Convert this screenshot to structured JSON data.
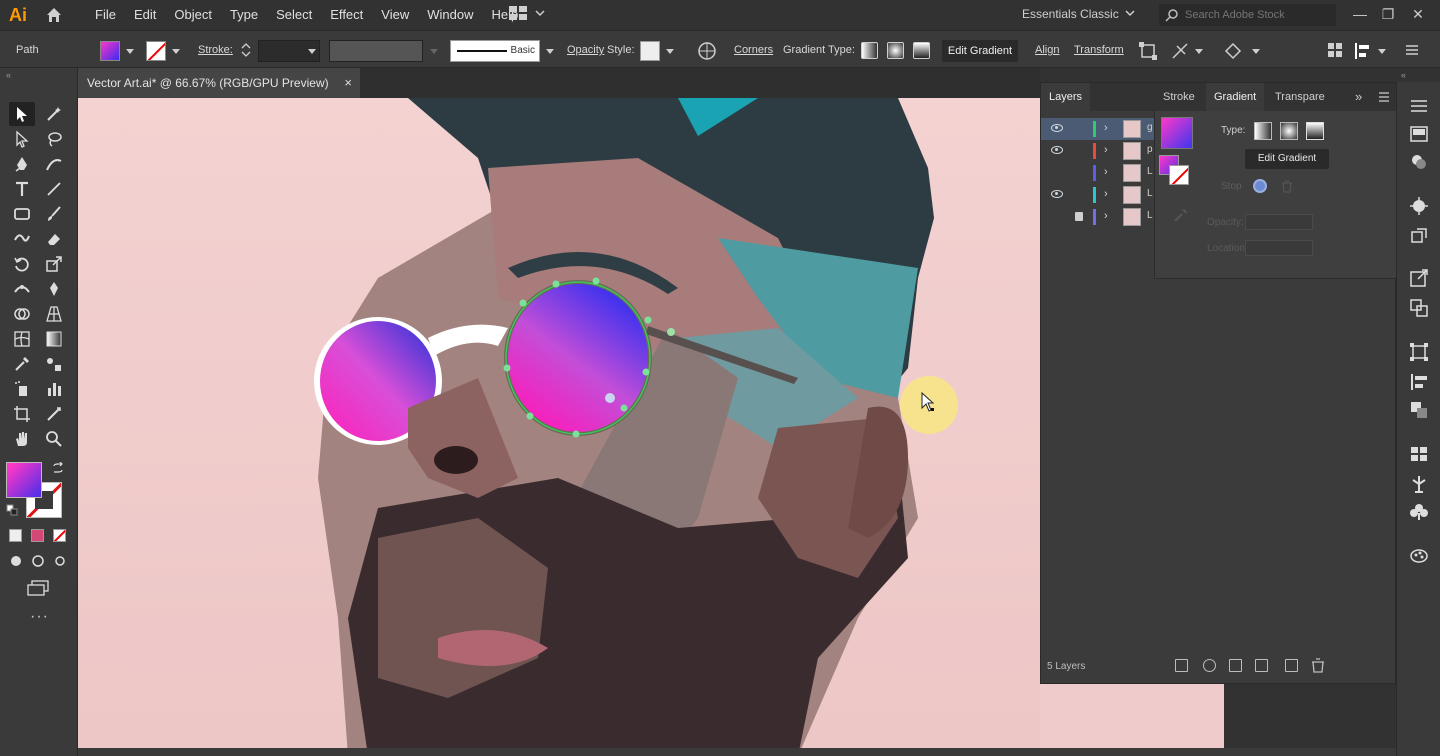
{
  "app": {
    "logo": "Ai",
    "workspace": "Essentials Classic",
    "stock_search_placeholder": "Search Adobe Stock"
  },
  "menu": [
    "File",
    "Edit",
    "Object",
    "Type",
    "Select",
    "Effect",
    "View",
    "Window",
    "Help"
  ],
  "control_bar": {
    "selection_type": "Path",
    "stroke_label": "Stroke:",
    "brush_label": "Basic",
    "opacity_label": "Opacity",
    "style_label": "Style:",
    "corners_label": "Corners",
    "gradient_type_label": "Gradient Type:",
    "edit_gradient_label": "Edit Gradient",
    "align_label": "Align",
    "transform_label": "Transform"
  },
  "document_tab": {
    "title": "Vector Art.ai* @ 66.67% (RGB/GPU Preview)",
    "close": "×"
  },
  "layers_panel": {
    "tabs": {
      "layers": "Layers",
      "stroke": "Stroke",
      "gradient": "Gradient",
      "transparency": "Transpare"
    },
    "expand": "»",
    "layers": [
      {
        "letter": "g",
        "color": "#2ecc71",
        "visible": true,
        "locked": false,
        "selected": true
      },
      {
        "letter": "p",
        "color": "#e74c3c",
        "visible": true,
        "locked": false,
        "selected": false
      },
      {
        "letter": "L",
        "color": "#5b5fe6",
        "visible": false,
        "locked": false,
        "selected": false
      },
      {
        "letter": "L",
        "color": "#29c6d6",
        "visible": true,
        "locked": false,
        "selected": false
      },
      {
        "letter": "L",
        "color": "#6b72e8",
        "visible": false,
        "locked": true,
        "selected": false
      }
    ],
    "count_label": "5 Layers"
  },
  "gradient_panel": {
    "type_label": "Type:",
    "edit_gradient": "Edit Gradient",
    "stop_label": "Stop",
    "opacity_label": "Opacity:",
    "location_label": "Location:"
  },
  "colors": {
    "accent_fill": "#ff38c8",
    "accent_fill_2": "#3b36f0",
    "selection": "#4a5b73",
    "canvas_bg": "#f2cfcf"
  }
}
